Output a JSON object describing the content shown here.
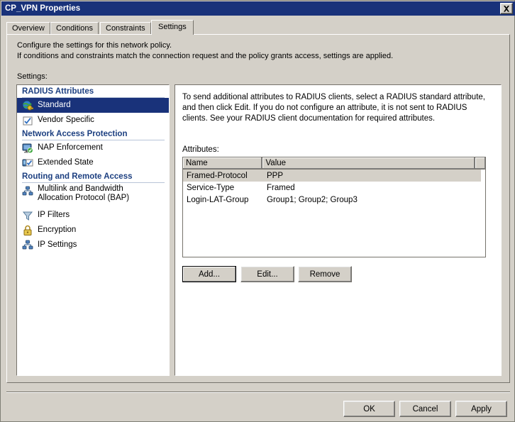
{
  "window": {
    "title": "CP_VPN Properties",
    "close_label": "Close",
    "titlebar_color": "#19327a",
    "face_color": "#d4d0c8"
  },
  "tabs": [
    {
      "label": "Overview",
      "active": false
    },
    {
      "label": "Conditions",
      "active": false
    },
    {
      "label": "Constraints",
      "active": false
    },
    {
      "label": "Settings",
      "active": true
    }
  ],
  "description": {
    "line1": "Configure the settings for this network policy.",
    "line2": "If conditions and constraints match the connection request and the policy grants access, settings are applied.",
    "settings_label": "Settings:"
  },
  "tree": {
    "groups": [
      {
        "header": "RADIUS Attributes",
        "items": [
          {
            "label": "Standard",
            "icon": "globe-key-icon",
            "selected": true
          },
          {
            "label": "Vendor Specific",
            "icon": "vendor-checkbox-icon",
            "selected": false
          }
        ]
      },
      {
        "header": "Network Access Protection",
        "items": [
          {
            "label": "NAP Enforcement",
            "icon": "monitor-green-check-icon",
            "selected": false
          },
          {
            "label": "Extended State",
            "icon": "monitor-blue-check-icon",
            "selected": false
          }
        ]
      },
      {
        "header": "Routing and Remote Access",
        "items": [
          {
            "label": "Multilink and Bandwidth",
            "label2": "Allocation Protocol (BAP)",
            "icon": "network-nodes-icon",
            "selected": false
          },
          {
            "label": "IP Filters",
            "icon": "funnel-icon",
            "selected": false
          },
          {
            "label": "Encryption",
            "icon": "padlock-icon",
            "selected": false
          },
          {
            "label": "IP Settings",
            "icon": "network-nodes-icon",
            "selected": false
          }
        ]
      }
    ]
  },
  "detail": {
    "intro": "To send additional attributes to RADIUS clients, select a RADIUS standard attribute, and then click Edit. If you do not configure an attribute, it is not sent to RADIUS clients. See your RADIUS client documentation for required attributes.",
    "attributes_label": "Attributes:",
    "grid": {
      "columns": [
        "Name",
        "Value"
      ],
      "rows": [
        {
          "name": "Framed-Protocol",
          "value": "PPP",
          "selected": true
        },
        {
          "name": "Service-Type",
          "value": "Framed",
          "selected": false
        },
        {
          "name": "Login-LAT-Group",
          "value": "Group1; Group2; Group3",
          "selected": false
        }
      ]
    },
    "buttons": {
      "add": "Add...",
      "edit": "Edit...",
      "remove": "Remove"
    }
  },
  "footer": {
    "ok": "OK",
    "cancel": "Cancel",
    "apply": "Apply"
  }
}
